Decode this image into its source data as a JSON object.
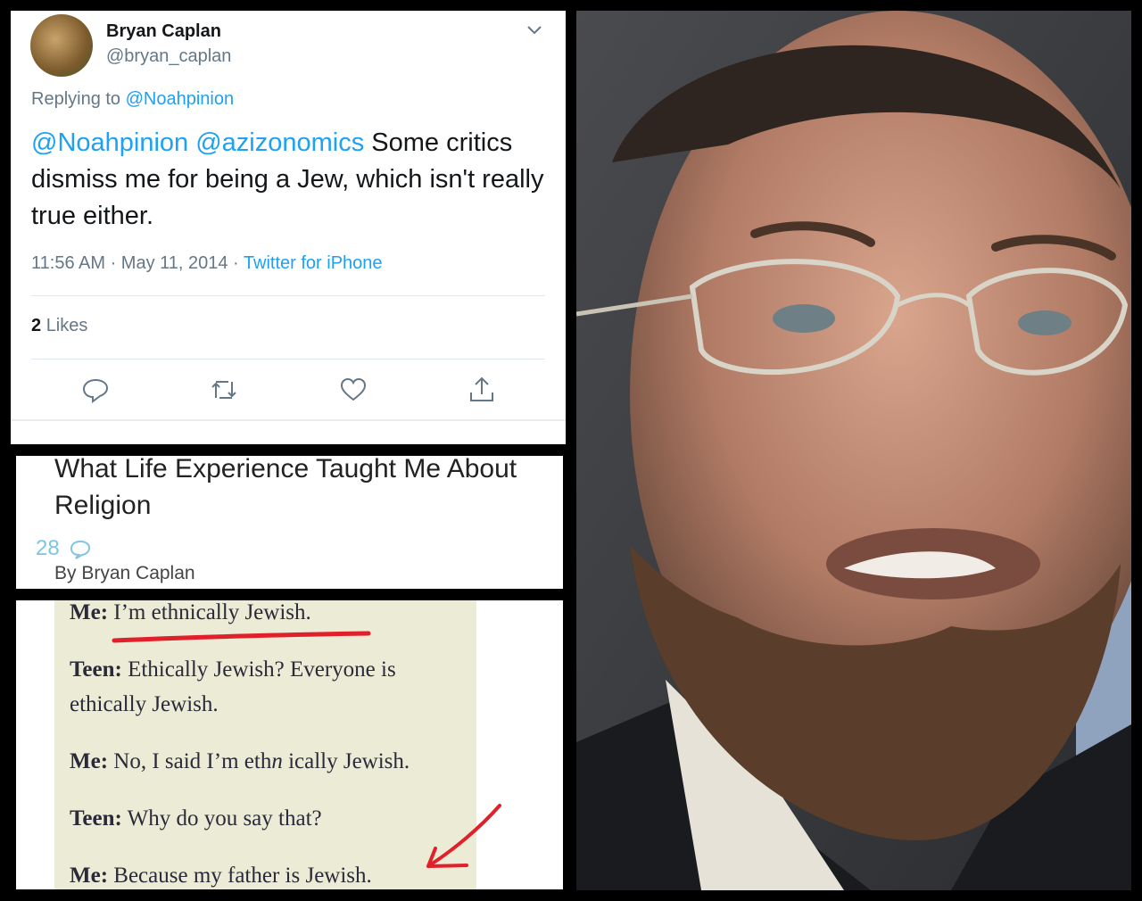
{
  "tweet": {
    "author_name": "Bryan Caplan",
    "author_handle": "@bryan_caplan",
    "replying_prefix": "Replying to",
    "replying_to": "@Noahpinion",
    "mentions": "@Noahpinion @azizonomics",
    "body": " Some critics dismiss me for being a Jew, which isn't really true either.",
    "time": "11:56 AM · May 11, 2014 · ",
    "source": "Twitter for iPhone",
    "likes_count": "2",
    "likes_label": "Likes",
    "icons": [
      "reply-icon",
      "retweet-icon",
      "like-icon",
      "share-icon"
    ]
  },
  "article": {
    "title": "What Life Experience Taught Me About Religion",
    "comment_count": "28",
    "byline": "By Bryan Caplan"
  },
  "dialog": {
    "lines": [
      {
        "speaker": "Me:",
        "text": " I’m ethnically Jewish."
      },
      {
        "speaker": "Teen:",
        "text": " Ethically Jewish? Everyone is ethically Jewish."
      },
      {
        "speaker": "Me:",
        "text": " No, I said I’m eth",
        "italic": "n",
        "text2": " ically Jewish."
      },
      {
        "speaker": "Teen:",
        "text": " Why do you say that?"
      },
      {
        "speaker": "Me:",
        "text": " Because my father is Jewish."
      }
    ],
    "annotation_color": "#e0202a"
  },
  "colors": {
    "link": "#1da1f2",
    "muted": "#657786",
    "dialog_bg": "#ecebd5"
  }
}
